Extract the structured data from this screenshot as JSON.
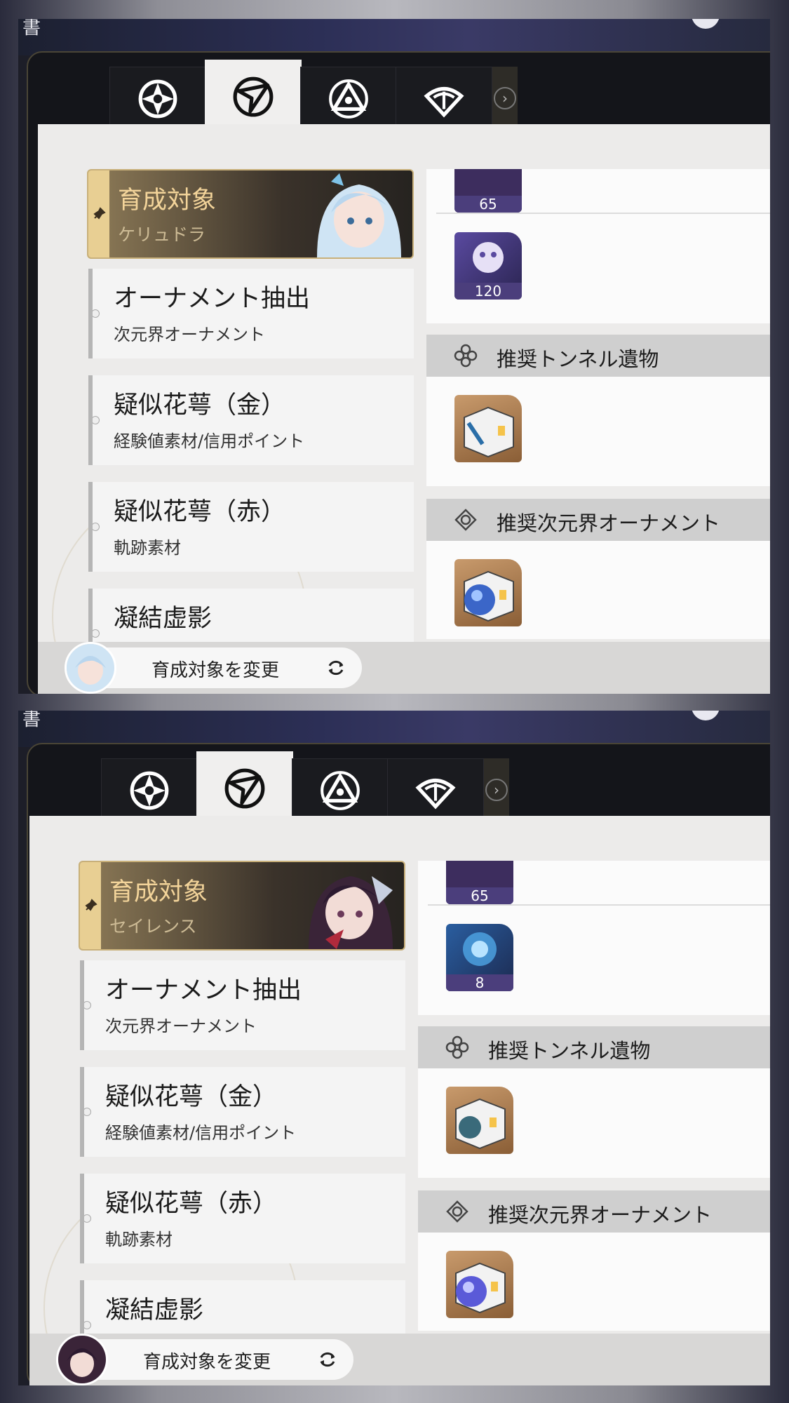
{
  "screens": [
    {
      "header_text": "書",
      "target": {
        "title": "育成対象",
        "name": "ケリュドラ"
      },
      "cards": [
        {
          "title": "オーナメント抽出",
          "subtitle": "次元界オーナメント"
        },
        {
          "title": "疑似花萼（金）",
          "subtitle": "経験値素材/信用ポイント"
        },
        {
          "title": "疑似花萼（赤）",
          "subtitle": "軌跡素材"
        },
        {
          "title": "凝結虚影",
          "subtitle": ""
        }
      ],
      "items": [
        {
          "count": "65"
        },
        {
          "count": "120"
        }
      ],
      "sections": [
        "推奨トンネル遺物",
        "推奨次元界オーナメント"
      ],
      "change_button": "育成対象を変更"
    },
    {
      "header_text": "書",
      "target": {
        "title": "育成対象",
        "name": "セイレンス"
      },
      "cards": [
        {
          "title": "オーナメント抽出",
          "subtitle": "次元界オーナメント"
        },
        {
          "title": "疑似花萼（金）",
          "subtitle": "経験値素材/信用ポイント"
        },
        {
          "title": "疑似花萼（赤）",
          "subtitle": "軌跡素材"
        },
        {
          "title": "凝結虚影",
          "subtitle": ""
        }
      ],
      "items": [
        {
          "count": "65"
        },
        {
          "count": "8"
        }
      ],
      "sections": [
        "推奨トンネル遺物",
        "推奨次元界オーナメント"
      ],
      "change_button": "育成対象を変更"
    }
  ],
  "tabs": [
    {
      "icon": "shield-cross-icon",
      "active": false
    },
    {
      "icon": "compass-arrow-icon",
      "active": true
    },
    {
      "icon": "triangle-emblem-icon",
      "active": false
    },
    {
      "icon": "fan-emblem-icon",
      "active": false
    }
  ],
  "colors": {
    "accent_gold": "#f3d49a",
    "item_purple": "#4b3e7c",
    "content_bg": "#ecebea"
  }
}
